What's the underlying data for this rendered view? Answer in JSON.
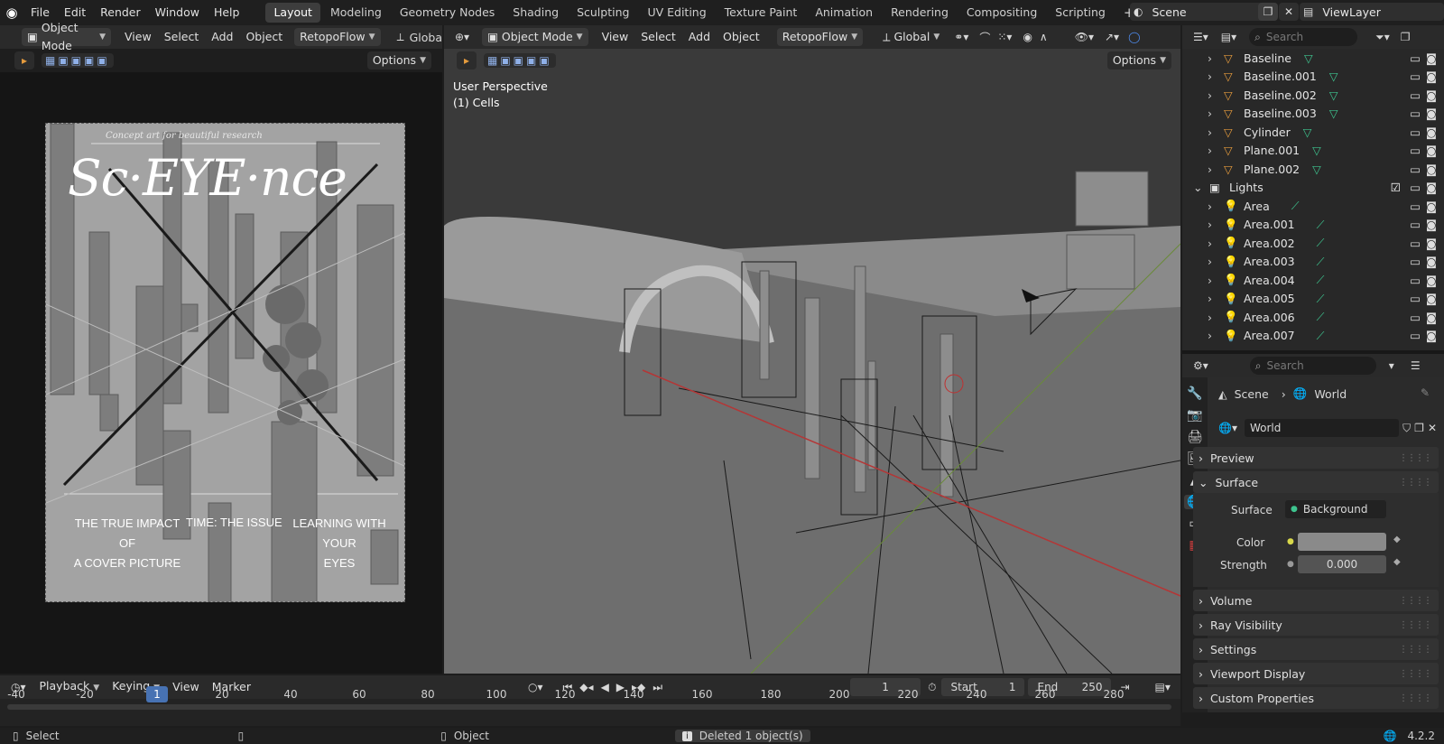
{
  "topbar": {
    "menus": [
      "File",
      "Edit",
      "Render",
      "Window",
      "Help"
    ],
    "workspaces": [
      "Layout",
      "Modeling",
      "Geometry Nodes",
      "Shading",
      "Sculpting",
      "UV Editing",
      "Texture Paint",
      "Animation",
      "Rendering",
      "Compositing",
      "Scripting"
    ],
    "active_workspace": "Layout",
    "add_tab": "+",
    "scene": "Scene",
    "view_layer": "ViewLayer"
  },
  "image_editor": {
    "mode": "Object Mode",
    "menus": [
      "View",
      "Select",
      "Add",
      "Object"
    ],
    "addon": "RetopoFlow",
    "orientation_partial": "Globa",
    "options": "Options"
  },
  "viewport": {
    "mode": "Object Mode",
    "menus": [
      "View",
      "Select",
      "Add",
      "Object"
    ],
    "addon": "RetopoFlow",
    "orientation": "Global",
    "options": "Options",
    "perspective_label": "User Perspective",
    "object_label": "(1) Cells"
  },
  "cover": {
    "kicker": "Concept art for beautiful research",
    "title": "Sc·EYE·nce",
    "col1_title_1": "THE TRUE IMPACT OF",
    "col1_title_2": "A COVER PICTURE",
    "col2_title": "TIME: THE ISSUE",
    "col3_title_1": "LEARNING WITH YOUR",
    "col3_title_2": "EYES"
  },
  "outliner": {
    "search_placeholder": "Search",
    "items": [
      {
        "name": "Baseline",
        "type": "mesh",
        "indent": 1
      },
      {
        "name": "Baseline.001",
        "type": "mesh",
        "indent": 1
      },
      {
        "name": "Baseline.002",
        "type": "mesh",
        "indent": 1
      },
      {
        "name": "Baseline.003",
        "type": "mesh",
        "indent": 1
      },
      {
        "name": "Cylinder",
        "type": "mesh",
        "indent": 1
      },
      {
        "name": "Plane.001",
        "type": "mesh",
        "indent": 1
      },
      {
        "name": "Plane.002",
        "type": "mesh",
        "indent": 1
      },
      {
        "name": "Lights",
        "type": "collection",
        "indent": 0
      },
      {
        "name": "Area",
        "type": "light",
        "indent": 1
      },
      {
        "name": "Area.001",
        "type": "light",
        "indent": 1
      },
      {
        "name": "Area.002",
        "type": "light",
        "indent": 1
      },
      {
        "name": "Area.003",
        "type": "light",
        "indent": 1
      },
      {
        "name": "Area.004",
        "type": "light",
        "indent": 1
      },
      {
        "name": "Area.005",
        "type": "light",
        "indent": 1
      },
      {
        "name": "Area.006",
        "type": "light",
        "indent": 1
      },
      {
        "name": "Area.007",
        "type": "light",
        "indent": 1
      }
    ]
  },
  "properties": {
    "search_placeholder": "Search",
    "breadcrumb_scene": "Scene",
    "breadcrumb_world": "World",
    "world_name": "World",
    "panels": {
      "preview": "Preview",
      "surface": "Surface",
      "volume": "Volume",
      "ray_visibility": "Ray Visibility",
      "settings": "Settings",
      "viewport_display": "Viewport Display",
      "custom_properties": "Custom Properties"
    },
    "surface_label": "Surface",
    "surface_value": "Background",
    "color_label": "Color",
    "color_value": "#8a8a8a",
    "strength_label": "Strength",
    "strength_value": "0.000"
  },
  "timeline": {
    "menus": [
      "Playback",
      "Keying",
      "View",
      "Marker"
    ],
    "current_frame": "1",
    "start_label": "Start",
    "start_value": "1",
    "end_label": "End",
    "end_value": "250",
    "ticks": [
      "-40",
      "-20",
      "1",
      "20",
      "40",
      "60",
      "80",
      "100",
      "120",
      "140",
      "160",
      "180",
      "200",
      "220",
      "240",
      "260",
      "280"
    ]
  },
  "statusbar": {
    "select": "Select",
    "object": "Object",
    "message": "Deleted 1 object(s)",
    "version": "4.2.2"
  },
  "colors": {
    "accent_blue": "#4772b3",
    "mesh_green": "#3ec48f",
    "light_orange": "#e59b3d",
    "viewport_bg": "#3d3d3d"
  }
}
